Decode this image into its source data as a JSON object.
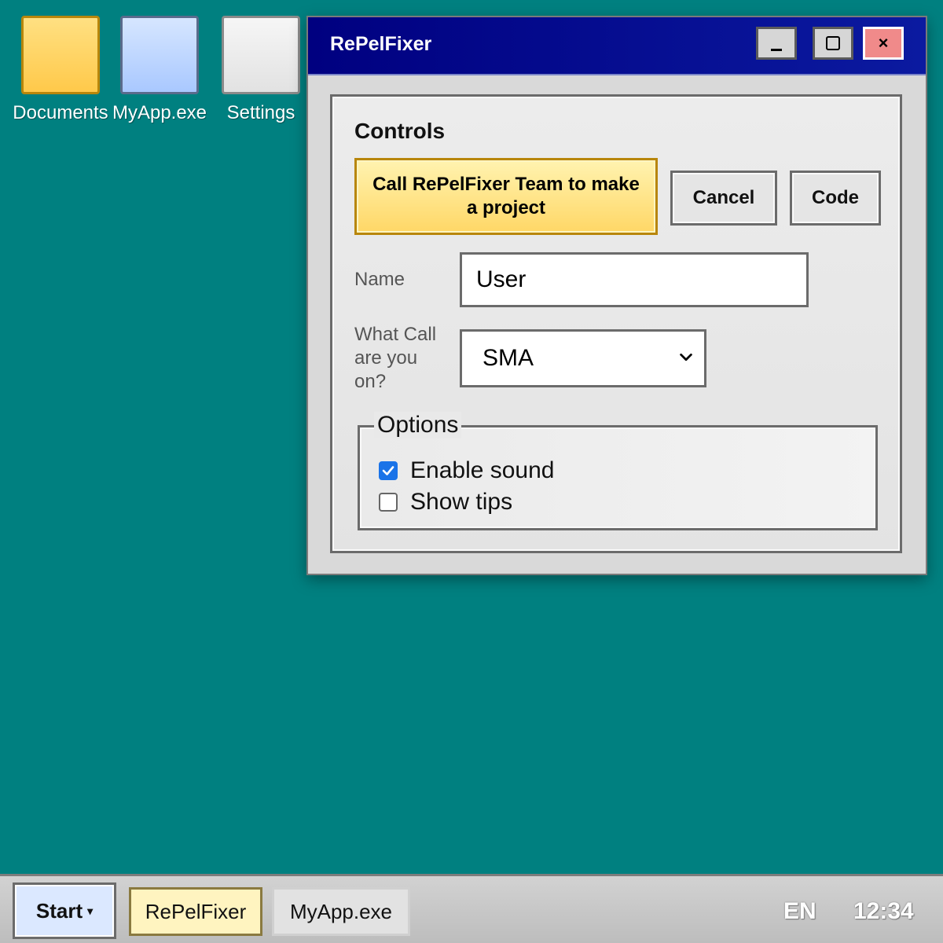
{
  "desktop": {
    "icons": [
      {
        "label": "Documents",
        "icon": "folder-icon"
      },
      {
        "label": "MyApp.exe",
        "icon": "app-icon"
      },
      {
        "label": "Settings",
        "icon": "settings-icon"
      }
    ]
  },
  "window": {
    "title": "RePelFixer",
    "close_glyph": "×",
    "controls_heading": "Controls",
    "primary_button": "Call RePelFixer Team to make a project",
    "cancel_button": "Cancel",
    "code_button": "Code",
    "name_label": "Name",
    "name_value": "User",
    "call_label": "What Call are you on?",
    "call_selected": "SMA",
    "options_legend": "Options",
    "options": [
      {
        "label": "Enable sound",
        "checked": true
      },
      {
        "label": "Show tips",
        "checked": false
      }
    ]
  },
  "taskbar": {
    "start_label": "Start",
    "start_caret": "▾",
    "items": [
      {
        "label": "RePelFixer",
        "active": true
      },
      {
        "label": "MyApp.exe",
        "active": false
      }
    ],
    "language": "EN",
    "clock": "12:34"
  },
  "colors": {
    "desktop": "#008080",
    "titlebar": "#000080",
    "primary_button": "#ffd766",
    "checkbox_checked": "#1a73e8",
    "close_button": "#f08a8a"
  }
}
